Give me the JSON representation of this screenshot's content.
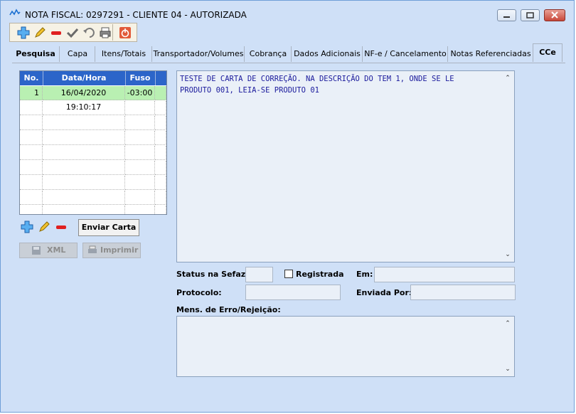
{
  "window": {
    "title": "NOTA FISCAL: 0297291 - CLIENTE 04 - AUTORIZADA",
    "controls": [
      "minimize-icon",
      "maximize-icon",
      "close-icon"
    ]
  },
  "toolbar": {
    "buttons": [
      {
        "name": "add-icon",
        "color": "#2f8fe0"
      },
      {
        "name": "edit-pencil-icon",
        "color": "#e0a800"
      },
      {
        "name": "remove-icon",
        "color": "#e02020"
      },
      {
        "name": "confirm-check-icon",
        "color": "#6a6a6a"
      },
      {
        "name": "undo-icon",
        "color": "#7a7a7a"
      },
      {
        "name": "printer-icon",
        "color": "#6a6a6a"
      },
      {
        "name": "power-icon",
        "color": "#e04020"
      }
    ]
  },
  "tabs": [
    {
      "label": "Pesquisa"
    },
    {
      "label": "Capa"
    },
    {
      "label": "Itens/Totais"
    },
    {
      "label": "Transportador/Volumes"
    },
    {
      "label": "Cobrança"
    },
    {
      "label": "Dados Adicionais"
    },
    {
      "label": "NF-e / Cancelamento"
    },
    {
      "label": "Notas Referenciadas"
    },
    {
      "label": "CCe"
    }
  ],
  "grid": {
    "headers": [
      "No.",
      "Data/Hora",
      "Fuso"
    ],
    "rows": [
      {
        "no": "1",
        "datetime": "16/04/2020 19:10:17",
        "fuso": "-03:00"
      }
    ]
  },
  "actions": {
    "enviar_carta": "Enviar Carta",
    "xml": "XML",
    "imprimir": "Imprimir"
  },
  "memo": {
    "text": "TESTE DE CARTA DE CORREÇÃO. NA DESCRIÇÃO DO TEM 1, ONDE SE LE\nPRODUTO 001, LEIA-SE PRODUTO 01"
  },
  "form": {
    "status_label": "Status na Sefaz:",
    "status_value": "",
    "registrada_label": "Registrada",
    "em_label": "Em:",
    "em_value": "",
    "protocolo_label": "Protocolo:",
    "protocolo_value": "",
    "enviada_por_label": "Enviada Por:",
    "enviada_por_value": "",
    "erro_label": "Mens. de Erro/Rejeição:",
    "erro_value": ""
  }
}
